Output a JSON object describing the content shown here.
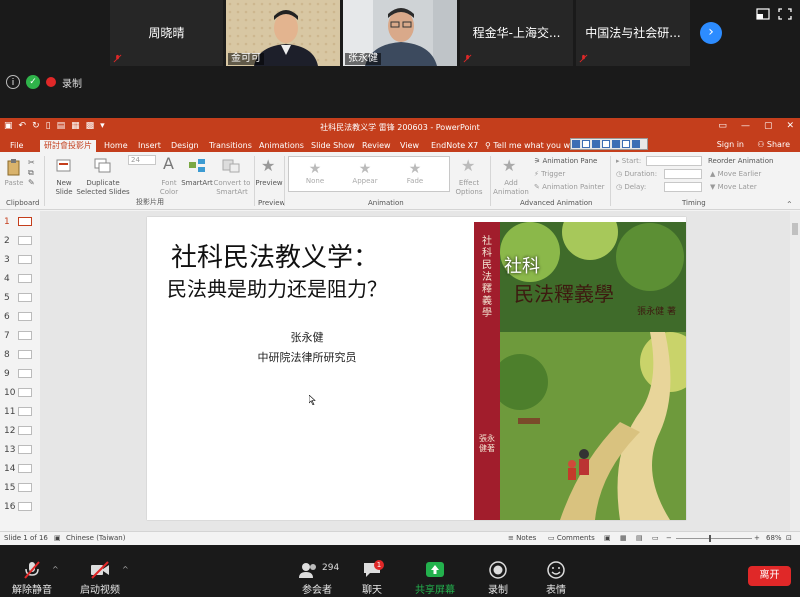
{
  "zoom": {
    "participants": [
      {
        "name": "周晓晴"
      },
      {
        "name": "金可可"
      },
      {
        "name": "张永健"
      },
      {
        "name": "程金华-上海交..."
      },
      {
        "name": "中国法与社会研..."
      }
    ],
    "record_label": "录制",
    "toolbar": {
      "unmute": "解除静音",
      "start_video": "启动视频",
      "participants": "参会者",
      "participant_count": "294",
      "chat": "聊天",
      "chat_badge": "1",
      "share_screen": "共享屏幕",
      "record": "录制",
      "reactions": "表情",
      "leave": "离开"
    }
  },
  "ppt": {
    "window_title": "社科民法教义学 雷锋 200603 - PowerPoint",
    "tabs": [
      "File",
      "研討會投影片",
      "Home",
      "Insert",
      "Design",
      "Transitions",
      "Animations",
      "Slide Show",
      "Review",
      "View",
      "EndNote X7"
    ],
    "tell_me": "Tell me what you want",
    "sign_in": "Sign in",
    "share": "Share",
    "ribbon": {
      "paste": "Paste",
      "clipboard": "Clipboard",
      "new_slide": "New",
      "new_slide_2": "Slide",
      "duplicate": "Duplicate",
      "duplicate_2": "Selected Slides",
      "group_slides": "投影片用",
      "font_size": "24",
      "font_color": "Font",
      "font_color_2": "Color",
      "smartart": "SmartArt",
      "convert": "Convert to",
      "convert_2": "SmartArt",
      "preview": "Preview",
      "preview_group": "Preview",
      "anim_none": "None",
      "anim_appear": "Appear",
      "anim_fade": "Fade",
      "effect_options": "Effect",
      "effect_options_2": "Options",
      "animation_group": "Animation",
      "add_animation": "Add",
      "add_animation_2": "Animation",
      "animation_pane": "Animation Pane",
      "trigger": "Trigger",
      "animation_painter": "Animation Painter",
      "advanced_group": "Advanced Animation",
      "start": "Start:",
      "duration": "Duration:",
      "delay": "Delay:",
      "reorder": "Reorder Animation",
      "move_earlier": "Move Earlier",
      "move_later": "Move Later",
      "timing_group": "Timing"
    },
    "slide_numbers": [
      "1",
      "2",
      "3",
      "4",
      "5",
      "6",
      "7",
      "8",
      "9",
      "10",
      "11",
      "12",
      "13",
      "14",
      "15",
      "16"
    ],
    "slide": {
      "title_line1": "社科民法教义学：",
      "title_line2": "民法典是助力还是阻力？",
      "author": "张永健",
      "affiliation": "中研院法律所研究员",
      "cover_title_a": "社科",
      "cover_title_b": "民法釋義學",
      "cover_author": "張永健 著",
      "spine_title": "社科民法釋義學",
      "spine_author": "張永健著"
    },
    "status": {
      "slide_of": "Slide 1 of 16",
      "language": "Chinese (Taiwan)",
      "notes": "Notes",
      "comments": "Comments",
      "zoom": "68%"
    }
  }
}
